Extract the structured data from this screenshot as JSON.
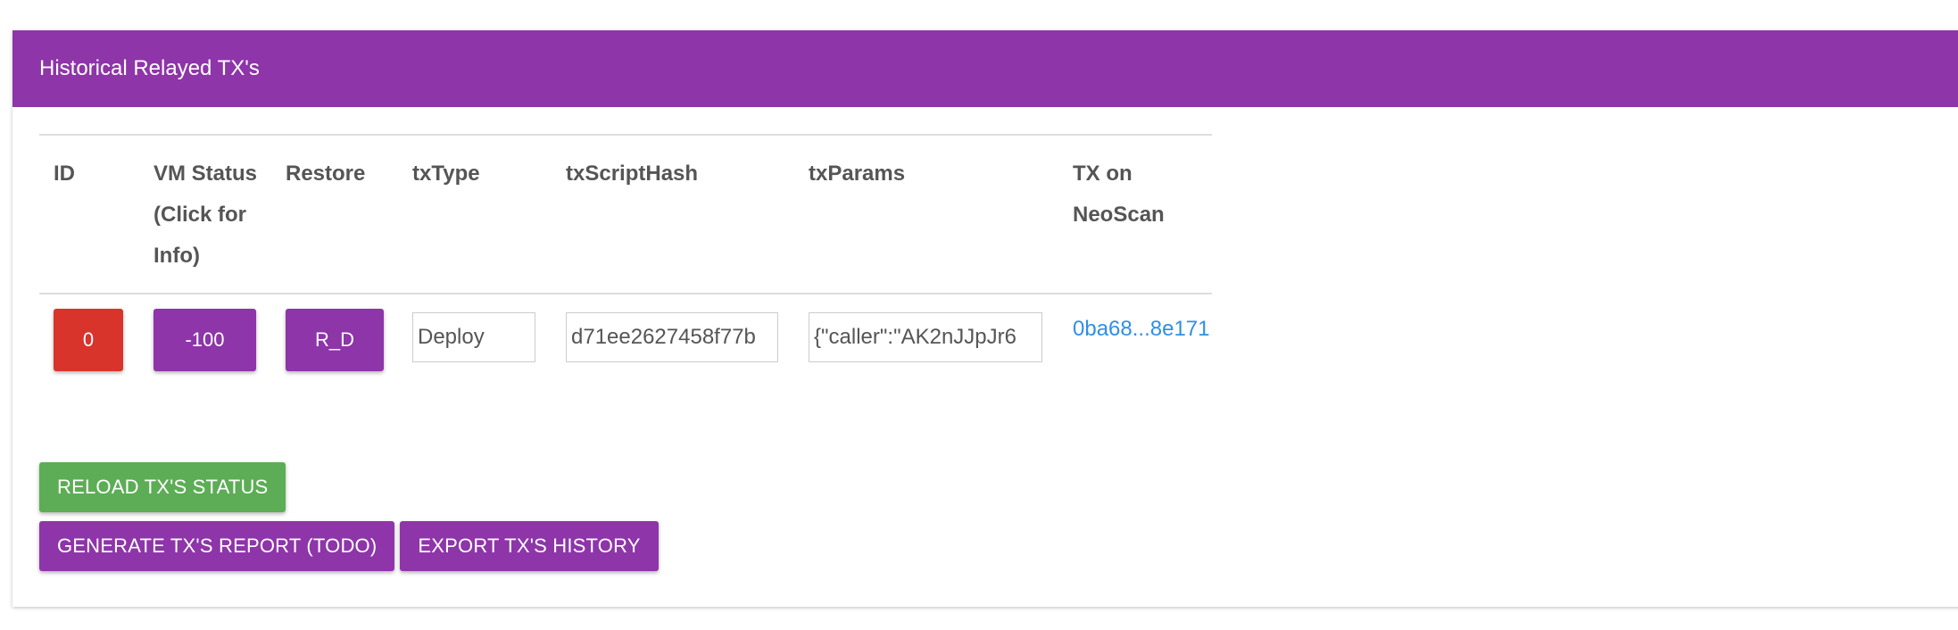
{
  "panel": {
    "title": "Historical Relayed TX's"
  },
  "table": {
    "headers": {
      "id": "ID",
      "vm_status": "VM Status (Click for Info)",
      "restore": "Restore",
      "tx_type": "txType",
      "tx_script_hash": "txScriptHash",
      "tx_params": "txParams",
      "tx_on_neoscan": "TX on NeoScan"
    },
    "rows": [
      {
        "id": "0",
        "vm_status": "-100",
        "restore": "R_D",
        "tx_type": "Deploy",
        "tx_script_hash": "d71ee2627458f77b",
        "tx_params": "{\"caller\":\"AK2nJJpJr6",
        "tx_link": "0ba68...8e171"
      }
    ]
  },
  "actions": {
    "reload": "RELOAD TX'S STATUS",
    "generate_report": "GENERATE TX'S REPORT (TODO)",
    "export_history": "EXPORT TX'S HISTORY"
  },
  "colors": {
    "header_purple": "#8e35a9",
    "danger_red": "#d9342b",
    "success_green": "#5cad55",
    "link_blue": "#2f8fe5"
  }
}
